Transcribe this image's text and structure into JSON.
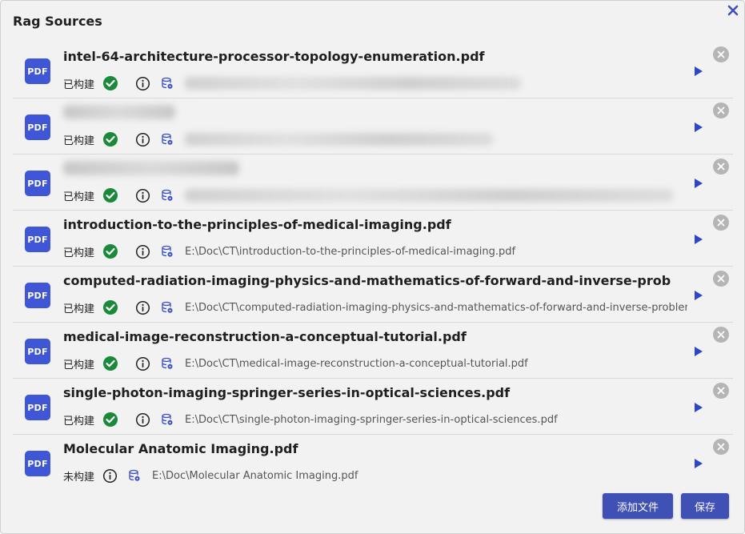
{
  "dialog": {
    "title": "Rag Sources",
    "add_button": "添加文件",
    "save_button": "保存"
  },
  "colors": {
    "accent": "#3f51b5",
    "pdf_icon_bg": "#3f56d6",
    "success": "#1a8a3a",
    "play": "#2f46c8",
    "delete_bg": "#b5b5b5"
  },
  "icons": {
    "file": "pdf-icon",
    "built": "check-circle-icon",
    "info": "info-icon",
    "database": "database-icon",
    "run": "play-icon",
    "remove": "close-circle-icon"
  },
  "pdf_label": "PDF",
  "sources": [
    {
      "name": "intel-64-architecture-processor-topology-enumeration.pdf",
      "status": "已构建",
      "built": true,
      "path": "",
      "name_blurred": false,
      "path_blurred": true
    },
    {
      "name": "",
      "status": "已构建",
      "built": true,
      "path": "",
      "name_blurred": true,
      "path_blurred": true
    },
    {
      "name": "",
      "status": "已构建",
      "built": true,
      "path": "",
      "name_blurred": true,
      "path_blurred": true
    },
    {
      "name": "introduction-to-the-principles-of-medical-imaging.pdf",
      "status": "已构建",
      "built": true,
      "path": "E:\\Doc\\CT\\introduction-to-the-principles-of-medical-imaging.pdf",
      "name_blurred": false,
      "path_blurred": false
    },
    {
      "name": "computed-radiation-imaging-physics-and-mathematics-of-forward-and-inverse-problems.pdf",
      "status": "已构建",
      "built": true,
      "path": "E:\\Doc\\CT\\computed-radiation-imaging-physics-and-mathematics-of-forward-and-inverse-problems.pdf",
      "name_blurred": false,
      "path_blurred": false
    },
    {
      "name": "medical-image-reconstruction-a-conceptual-tutorial.pdf",
      "status": "已构建",
      "built": true,
      "path": "E:\\Doc\\CT\\medical-image-reconstruction-a-conceptual-tutorial.pdf",
      "name_blurred": false,
      "path_blurred": false
    },
    {
      "name": "single-photon-imaging-springer-series-in-optical-sciences.pdf",
      "status": "已构建",
      "built": true,
      "path": "E:\\Doc\\CT\\single-photon-imaging-springer-series-in-optical-sciences.pdf",
      "name_blurred": false,
      "path_blurred": false
    },
    {
      "name": "Molecular Anatomic Imaging.pdf",
      "status": "未构建",
      "built": false,
      "path": "E:\\Doc\\Molecular Anatomic Imaging.pdf",
      "name_blurred": false,
      "path_blurred": false
    }
  ]
}
